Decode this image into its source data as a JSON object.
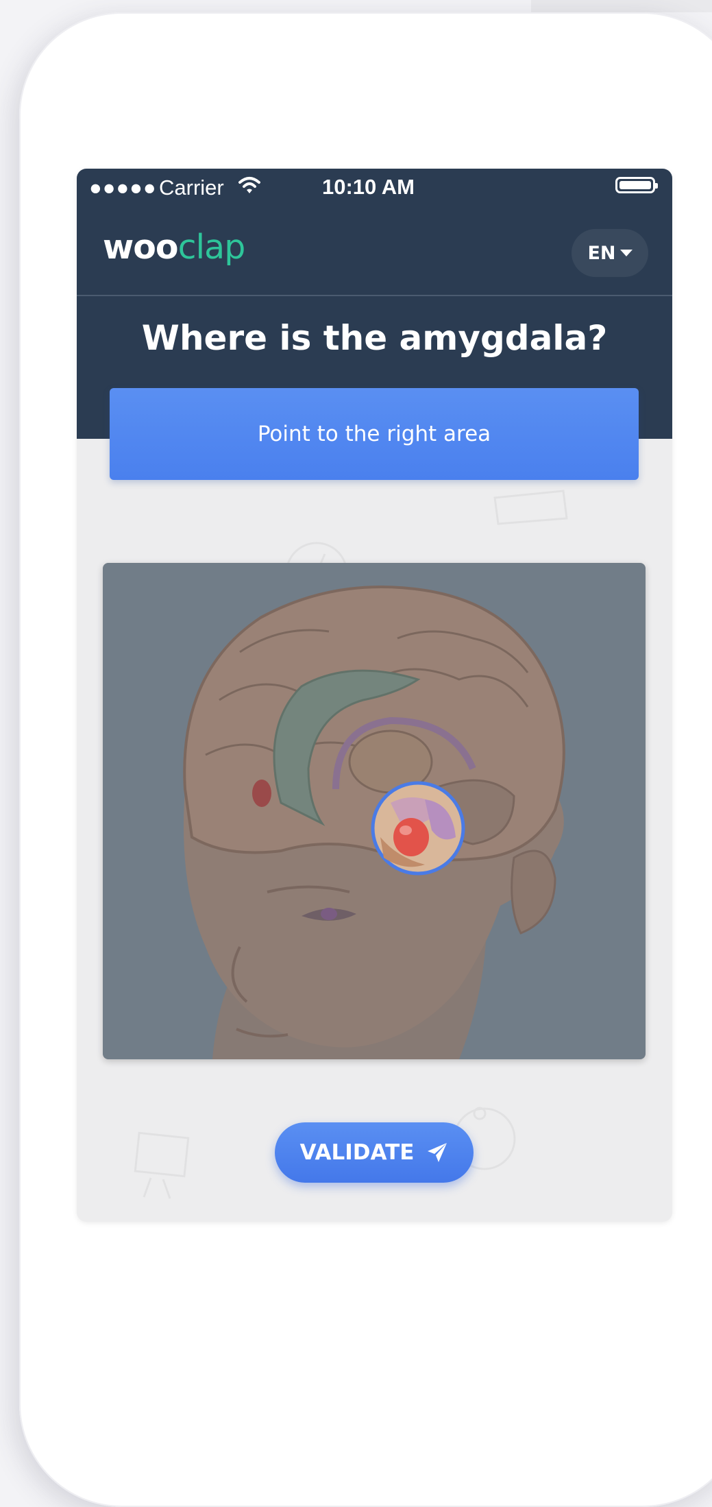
{
  "status_bar": {
    "signal": "●●●●●",
    "carrier": "Carrier",
    "time": "10:10 AM",
    "wifi_icon": "wifi-icon",
    "battery_icon": "battery-icon"
  },
  "header": {
    "logo_part1": "woo",
    "logo_part2": "clap",
    "language": "EN",
    "brand_color": "#2ec59a",
    "header_color": "#2b3c52"
  },
  "question": {
    "title": "Where is the amygdala?",
    "instruction": "Point to the right area"
  },
  "image": {
    "subject": "brain-anatomy-illustration",
    "marker_icon": "selection-marker-icon"
  },
  "actions": {
    "validate_label": "VALIDATE",
    "validate_icon": "send-icon",
    "accent_color": "#4a80ee"
  }
}
